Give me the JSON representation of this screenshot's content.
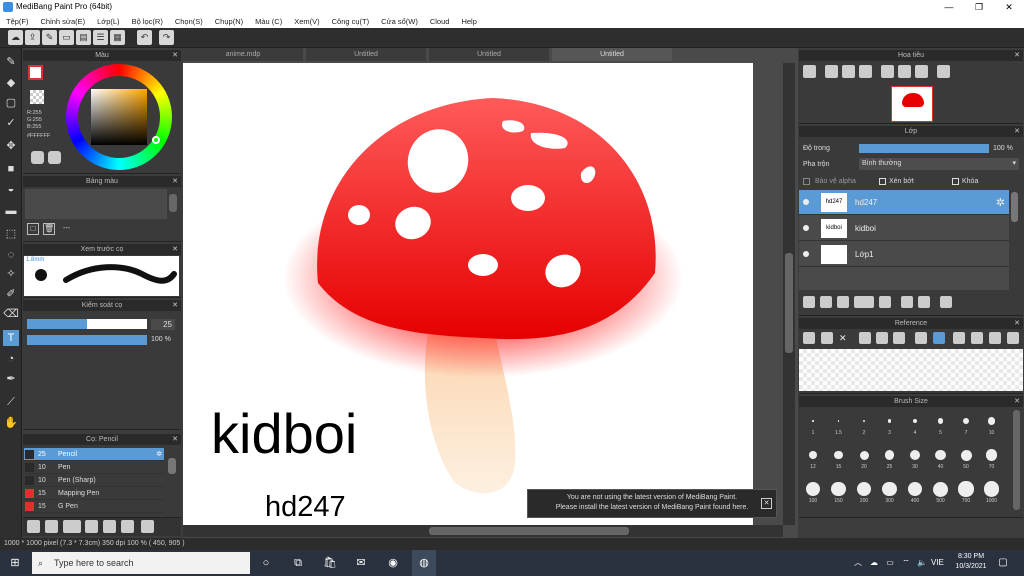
{
  "window": {
    "title": "MediBang Paint Pro (64bit)",
    "min": "—",
    "max": "❐",
    "close": "✕"
  },
  "menu": [
    "Tệp(F)",
    "Chỉnh sửa(E)",
    "Lớp(L)",
    "Bộ lọc(R)",
    "Chọn(S)",
    "Chụp(N)",
    "Màu (C)",
    "Xem(V)",
    "Công cụ(T)",
    "Cửa sổ(W)",
    "Cloud",
    "Help"
  ],
  "tabs": [
    "anime.mdp",
    "Untitled",
    "Untitled",
    "Untitled"
  ],
  "color_panel": {
    "title": "Màu",
    "rgb": [
      "R:255",
      "G:255",
      "B:255"
    ],
    "hex": "#FFFFFF"
  },
  "palette_panel": {
    "title": "Bảng màu",
    "dash": "---"
  },
  "brush_preview": {
    "title": "Xem trước cọ",
    "size": "1.8mm"
  },
  "brush_control": {
    "title": "Kiểm soát cọ",
    "size": "25",
    "opacity": "100 %",
    "size_fill": 0.5,
    "opacity_fill": 1.0
  },
  "brush_list": {
    "title": "Cọ: Pencil",
    "items": [
      {
        "size": "25",
        "name": "Pencil",
        "color": "#2a2a2a",
        "selected": true
      },
      {
        "size": "10",
        "name": "Pen",
        "color": "#2a2a2a",
        "selected": false
      },
      {
        "size": "10",
        "name": "Pen (Sharp)",
        "color": "#2a2a2a",
        "selected": false
      },
      {
        "size": "15",
        "name": "Mapping Pen",
        "color": "#e03030",
        "selected": false
      },
      {
        "size": "15",
        "name": "G Pen",
        "color": "#e03030",
        "selected": false
      }
    ]
  },
  "canvas": {
    "big_text": "kidboi",
    "small_text": "hd247"
  },
  "navigator": {
    "title": "Hoa tiêu"
  },
  "layer_panel": {
    "title": "Lớp",
    "opacity_label": "Độ trong",
    "opacity_value": "100 %",
    "blend_label": "Pha trộn",
    "blend_value": "Bình thường",
    "protect_alpha": "Bảo vệ alpha",
    "clipping": "Xén bớt",
    "lock": "Khóa",
    "layers": [
      {
        "thumb": "hd247",
        "name": "hd247",
        "selected": true
      },
      {
        "thumb": "kidboi",
        "name": "kidboi",
        "selected": false
      },
      {
        "thumb": "",
        "name": "Lớp1",
        "selected": false
      }
    ]
  },
  "reference": {
    "title": "Reference"
  },
  "brush_size": {
    "title": "Brush Size",
    "sizes": [
      "1",
      "1.5",
      "2",
      "3",
      "4",
      "5",
      "7",
      "10",
      "12",
      "15",
      "20",
      "25",
      "30",
      "40",
      "50",
      "70",
      "100",
      "150",
      "200",
      "300",
      "400",
      "500",
      "700",
      "1000"
    ]
  },
  "notice": {
    "line1": "You are not using the latest version of MediBang Paint.",
    "line2": "Please install the latest version of MediBang Paint found here."
  },
  "status": "1000 * 1000 pixel  (7.3 * 7.3cm)  350 dpi  100 %  ( 450, 905 )",
  "taskbar": {
    "search": "Type here to search",
    "lang": "VIE",
    "time": "8:30 PM",
    "date": "10/3/2021"
  },
  "colors": {
    "accent": "#5b9bd5",
    "mushroom_cap": "#ee1a1a",
    "stem": "#fbdcb8"
  }
}
